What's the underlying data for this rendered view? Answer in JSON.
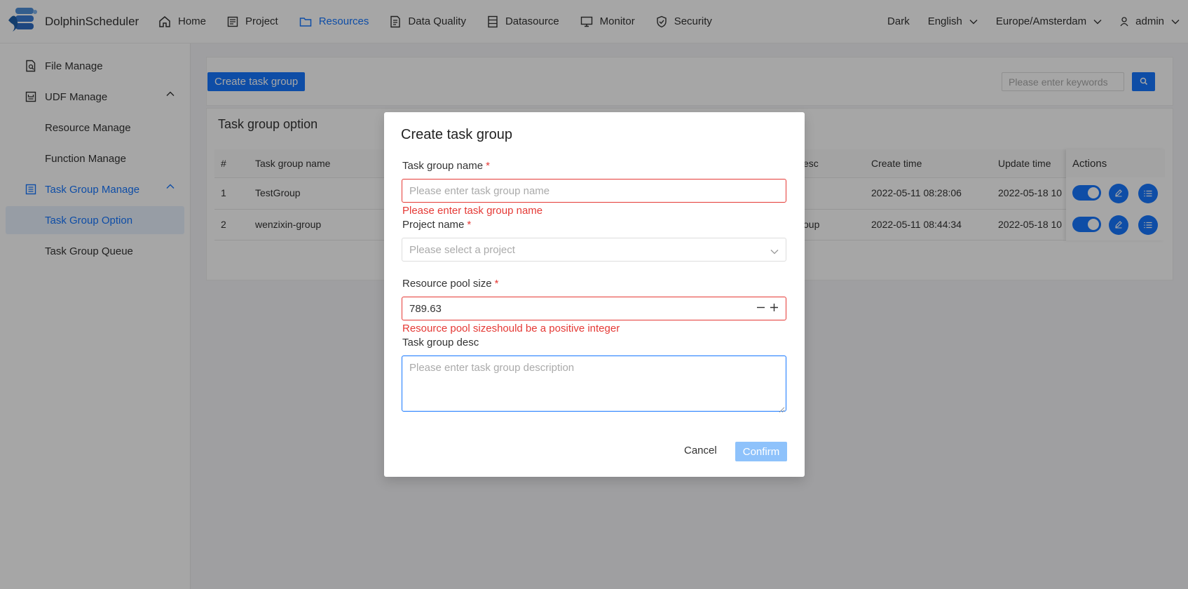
{
  "header": {
    "logo_text": "DolphinScheduler",
    "nav": [
      {
        "label": "Home",
        "icon": "home-icon"
      },
      {
        "label": "Project",
        "icon": "project-icon"
      },
      {
        "label": "Resources",
        "icon": "folder-icon",
        "active": true
      },
      {
        "label": "Data Quality",
        "icon": "data-quality-icon"
      },
      {
        "label": "Datasource",
        "icon": "datasource-icon"
      },
      {
        "label": "Monitor",
        "icon": "monitor-icon"
      },
      {
        "label": "Security",
        "icon": "shield-icon"
      }
    ],
    "theme": "Dark",
    "language": "English",
    "timezone": "Europe/Amsterdam",
    "user": "admin"
  },
  "sidebar": {
    "items": [
      {
        "label": "File Manage"
      },
      {
        "label": "UDF Manage"
      },
      {
        "label": "Resource Manage"
      },
      {
        "label": "Function Manage"
      },
      {
        "label": "Task Group Manage"
      },
      {
        "label": "Task Group Option"
      },
      {
        "label": "Task Group Queue"
      }
    ]
  },
  "toolbar": {
    "create_label": "Create task group",
    "search_placeholder": "Please enter keywords"
  },
  "table": {
    "title": "Task group option",
    "columns": [
      "#",
      "Task group name",
      "esc",
      "Create time",
      "Update time",
      "Actions"
    ],
    "rows": [
      {
        "index": "1",
        "name": "TestGroup",
        "desc": "",
        "create_time": "2022-05-11 08:28:06",
        "update_time": "2022-05-18 10"
      },
      {
        "index": "2",
        "name": "wenzixin-group",
        "desc": "oup",
        "create_time": "2022-05-11 08:44:34",
        "update_time": "2022-05-18 10"
      }
    ]
  },
  "modal": {
    "title": "Create task group",
    "name_label": "Task group name",
    "name_placeholder": "Please enter task group name",
    "name_error": "Please enter task group name",
    "project_label": "Project name",
    "project_placeholder": "Please select a project",
    "pool_label": "Resource pool size",
    "pool_value": "789.63",
    "pool_error": "Resource pool sizeshould be a positive integer",
    "desc_label": "Task group desc",
    "desc_placeholder": "Please enter task group description",
    "required_mark": "*",
    "cancel_label": "Cancel",
    "confirm_label": "Confirm"
  },
  "colors": {
    "accent": "#1677ff",
    "error": "#e53935",
    "confirm_disabled": "#8ec2fb"
  }
}
